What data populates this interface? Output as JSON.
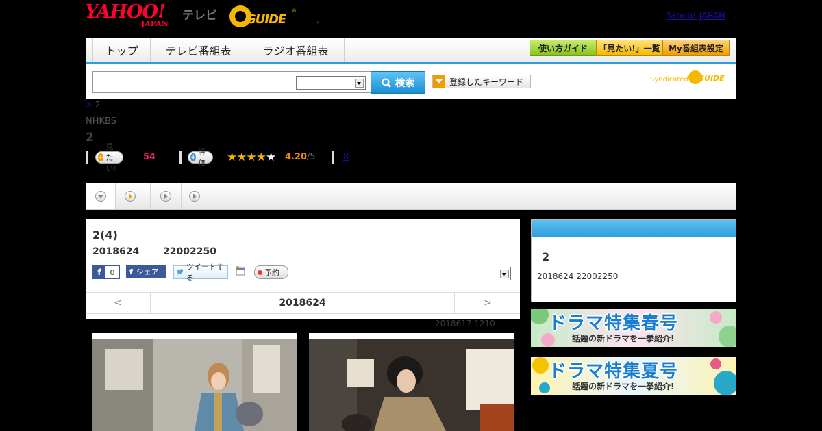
{
  "header": {
    "logo_text": "YAHOO!",
    "logo_sub": "JAPAN",
    "tv_label": "テレビ",
    "gguide_text": "GUIDE",
    "gguide_reg": "®",
    "dot": ",",
    "yahoo_japan_link": "Yahoo! JAPAN",
    "trail_dot": "."
  },
  "nav": {
    "tabs": [
      "トップ",
      "テレビ番組表",
      "ラジオ番組表"
    ],
    "buttons": [
      "使い方ガイド",
      "「見たい!」一覧",
      "My番組表設定"
    ]
  },
  "search": {
    "input_value": "",
    "select_value": "",
    "button_label": "検索",
    "keyword_button": "登録したキーワード",
    "syndicated": "Syndicated",
    "syndicated_guide": "GUIDE"
  },
  "program": {
    "breadcrumb_link": ">",
    "breadcrumb_text": "2",
    "channel": "NHKBS",
    "title": "2",
    "mitai_label": "見たい!",
    "mitai_count": "54",
    "hyouka_label": "評価",
    "rating": "4.20",
    "rating_max": "/5",
    "rating_stars": 4.2,
    "comments_link": "8"
  },
  "tabs_strip": {
    "tab2_suffix": "."
  },
  "episode": {
    "title": "2(4)",
    "date": "2018624",
    "time": "22002250",
    "fb_count": "0",
    "fb_share": "シェア",
    "tweet": "ツイートする",
    "reserve": "予約",
    "select_value": "",
    "prev": "<",
    "current_date": "2018624",
    "next": ">",
    "updated": "2018617  1210"
  },
  "sidebar": {
    "title": "2",
    "info": "2018624  22002250",
    "banner1_title": "ドラマ特集春号",
    "banner1_sub": "話題の新ドラマを一挙紹介!",
    "banner2_title": "ドラマ特集夏号",
    "banner2_sub": "話題の新ドラマを一挙紹介!"
  },
  "colors": {
    "accent_blue": "#29a0dc",
    "mitai_pink": "#e0245e",
    "rating_orange": "#f08c00",
    "star": "#f4b400"
  }
}
